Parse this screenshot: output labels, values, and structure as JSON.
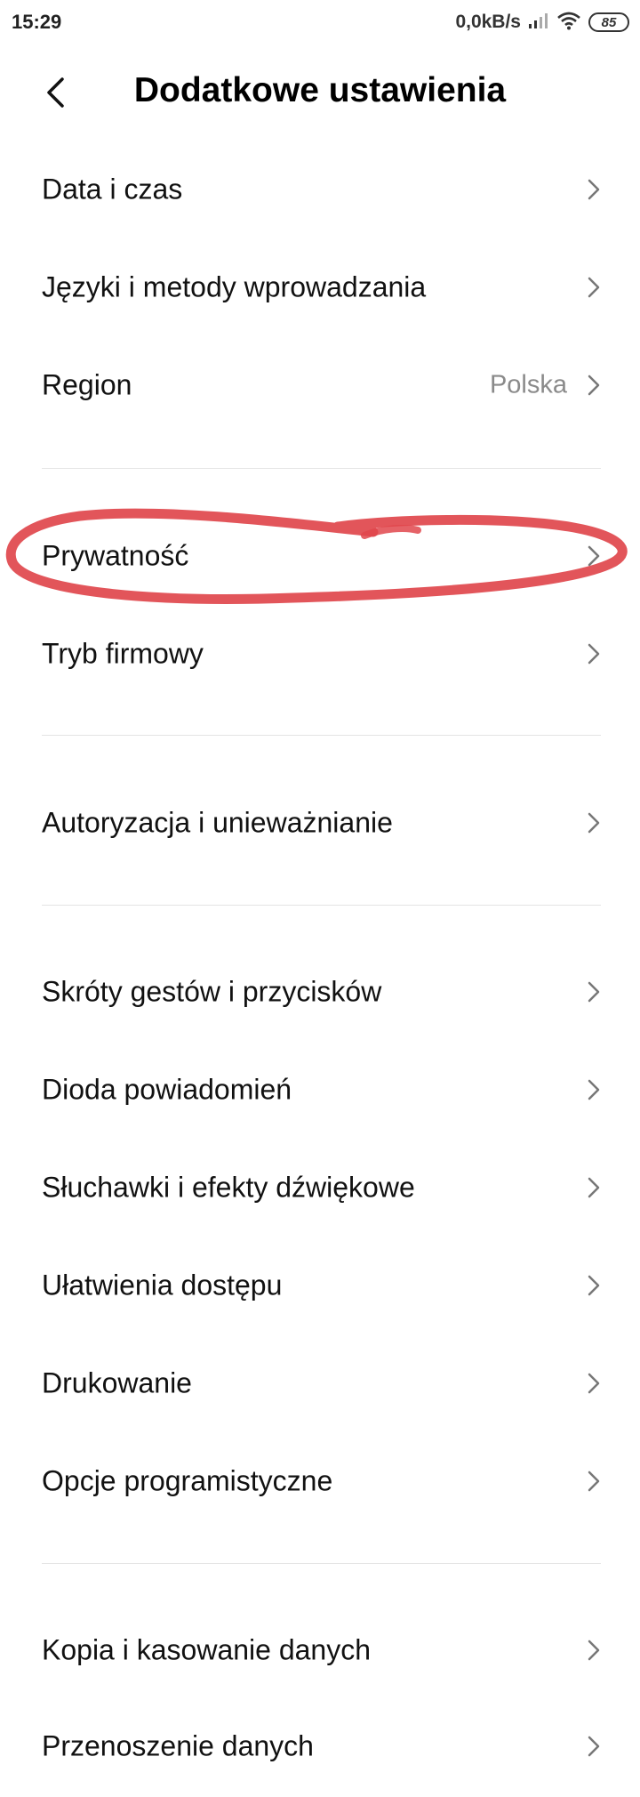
{
  "status_bar": {
    "time": "15:29",
    "net_speed": "0,0kB/s",
    "battery": "85",
    "icons": [
      "signal-icon",
      "wifi-icon",
      "battery-icon"
    ]
  },
  "header": {
    "title": "Dodatkowe ustawienia",
    "back_icon": "back-arrow-icon"
  },
  "items": [
    {
      "label": "Data i czas"
    },
    {
      "label": "Języki i metody wprowadzania"
    },
    {
      "label": "Region",
      "value": "Polska"
    },
    {
      "label": "Prywatność"
    },
    {
      "label": "Tryb firmowy"
    },
    {
      "label": "Autoryzacja i unieważnianie"
    },
    {
      "label": "Skróty gestów i przycisków"
    },
    {
      "label": "Dioda powiadomień"
    },
    {
      "label": "Słuchawki i efekty dźwiękowe"
    },
    {
      "label": "Ułatwienia dostępu"
    },
    {
      "label": "Drukowanie"
    },
    {
      "label": "Opcje programistyczne"
    },
    {
      "label": "Kopia i kasowanie danych"
    },
    {
      "label": "Przenoszenie danych"
    }
  ],
  "colors": {
    "annotation": "#e0474c",
    "divider": "#e4e4e4",
    "secondary_text": "#8a8a8a"
  }
}
